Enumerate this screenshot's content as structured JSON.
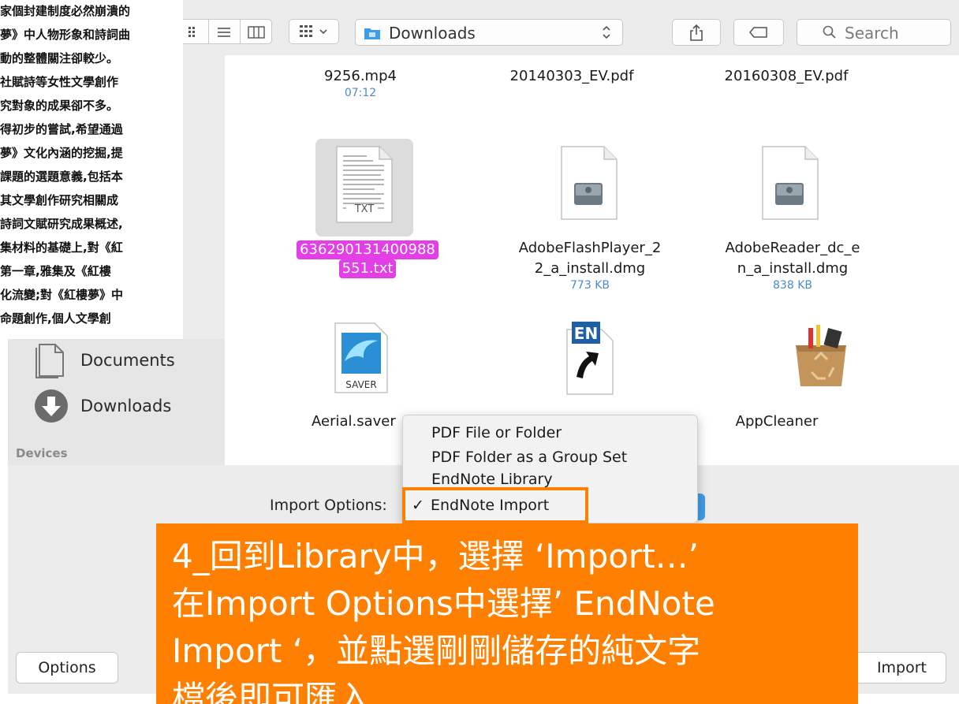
{
  "toolbar": {
    "view_icon_grid": "icon-view-icon",
    "view_list": "list-view-icon",
    "view_columns": "column-view-icon",
    "group_by": "group-by-icon",
    "location": "Downloads",
    "share": "share-icon",
    "tag": "tag-icon",
    "search_placeholder": "Search"
  },
  "overlay_text": {
    "lines": [
      "家個封建制度必然崩潰的",
      "夢》中人物形象和詩詞曲",
      "動的整體關注卻較少。",
      "社賦詩等女性文學創作",
      "究對象的成果卻不多。",
      "得初步的嘗試,希望通過",
      "夢》文化內涵的挖掘,提",
      "課題的選題意義,包括本",
      "其文學創作研究相關成",
      "詩詞文賦研究成果概述,",
      "集材料的基礎上,對《紅",
      "第一章,雅集及《紅樓",
      "化流變;對《紅樓夢》中",
      "命題創作,個人文學創"
    ]
  },
  "sidebar": {
    "items": [
      {
        "label": "Documents",
        "icon": "document-icon"
      },
      {
        "label": "Downloads",
        "icon": "downloads-icon"
      }
    ],
    "section_devices": "Devices"
  },
  "files": [
    {
      "name": "9256.mp4",
      "meta": "07:12"
    },
    {
      "name": "20140303_EV.pdf",
      "meta": ""
    },
    {
      "name": "20160308_EV.pdf",
      "meta": ""
    },
    {
      "name_line1": "636290131400988",
      "name_line2": "551.txt",
      "icon_label": "TXT",
      "selected": true
    },
    {
      "name_line1": "AdobeFlashPlayer_2",
      "name_line2": "2_a_install.dmg",
      "meta": "773 KB"
    },
    {
      "name_line1": "AdobeReader_dc_e",
      "name_line2": "n_a_install.dmg",
      "meta": "838 KB"
    },
    {
      "name": "Aerial.saver",
      "icon_label": "SAVER"
    },
    {
      "name": "",
      "icon_label": "EN"
    },
    {
      "name": "AppCleaner"
    }
  ],
  "import_options": {
    "label": "Import Options:",
    "menu_items": [
      {
        "label": "PDF File or Folder",
        "checked": false
      },
      {
        "label": "PDF Folder as a Group Set",
        "checked": false
      },
      {
        "label": "EndNote Library",
        "checked": false
      },
      {
        "label": "EndNote Import",
        "checked": true
      }
    ],
    "checkmark": "✓"
  },
  "buttons": {
    "options": "Options",
    "import": "Import"
  },
  "annotation": {
    "text": "4_回到Library中，選擇 ‘Import…’\n在Import Options中選擇’ EndNote\nImport ‘，並點選剛剛儲存的純文字\n檔後即可匯入"
  },
  "colors": {
    "accent_blue": "#3f9de8",
    "annotation_orange": "#ff8000",
    "selection_magenta": "#e33fe6"
  }
}
